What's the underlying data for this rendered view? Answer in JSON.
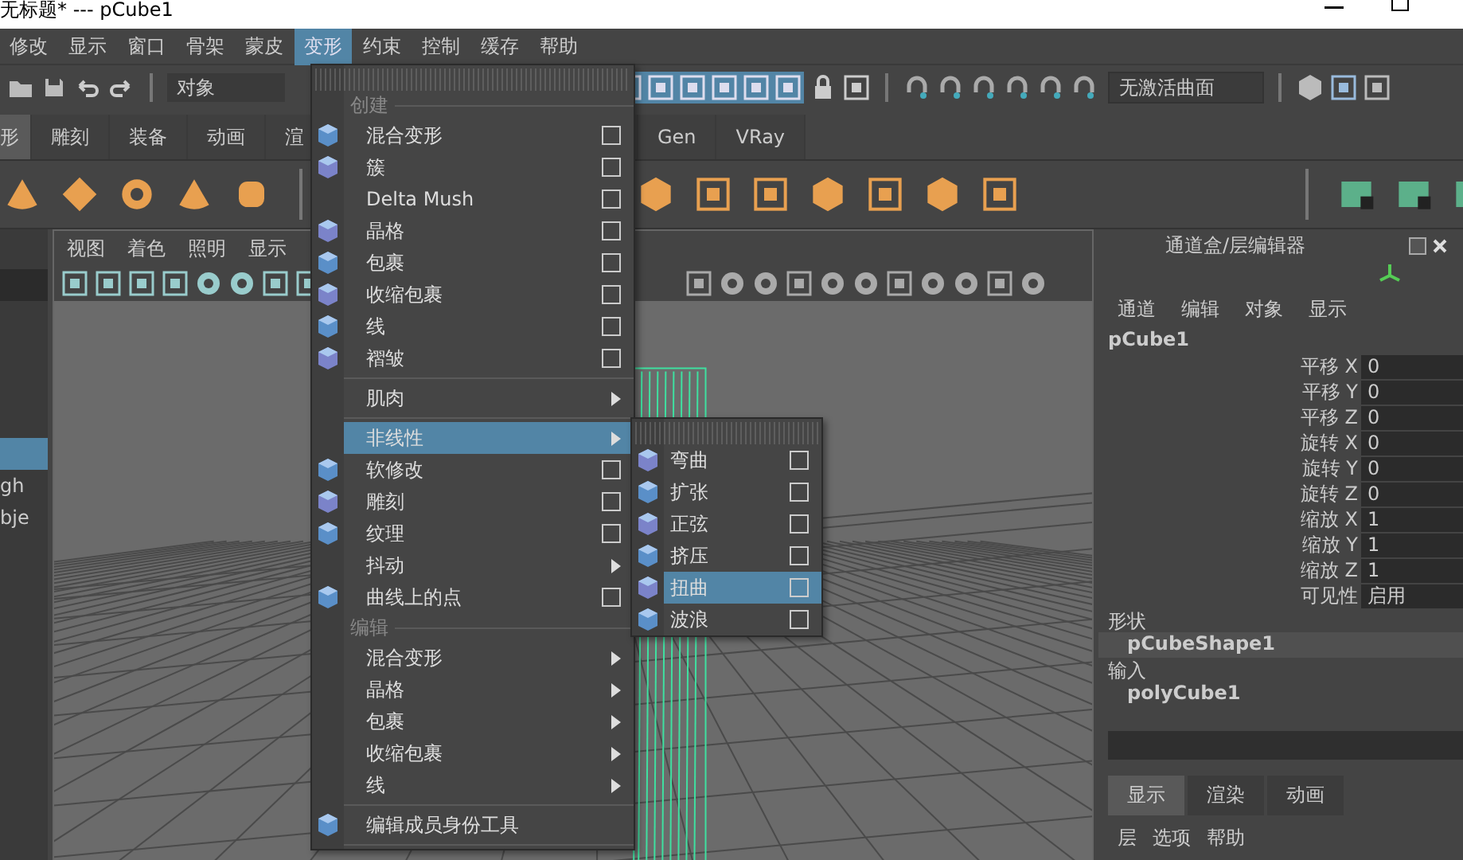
{
  "window": {
    "title": "无标题*   ---   pCube1"
  },
  "menu_bar": [
    {
      "label": "修改",
      "selected": false
    },
    {
      "label": "显示",
      "selected": false
    },
    {
      "label": "窗口",
      "selected": false
    },
    {
      "label": "骨架",
      "selected": false
    },
    {
      "label": "蒙皮",
      "selected": false
    },
    {
      "label": "变形",
      "selected": true
    },
    {
      "label": "约束",
      "selected": false
    },
    {
      "label": "控制",
      "selected": false
    },
    {
      "label": "缓存",
      "selected": false
    },
    {
      "label": "帮助",
      "selected": false
    }
  ],
  "toolbar": {
    "mode_dropdown": "对象",
    "live_surface_field": "无激活曲面"
  },
  "shelf_tabs": [
    {
      "label": "形",
      "selected": true
    },
    {
      "label": "雕刻",
      "selected": false
    },
    {
      "label": "装备",
      "selected": false
    },
    {
      "label": "动画",
      "selected": false
    },
    {
      "label": "渲",
      "selected": false
    },
    {
      "label": "Gen",
      "selected": false
    },
    {
      "label": "VRay",
      "selected": false
    }
  ],
  "outliner": {
    "rows": [
      {
        "selected": true
      },
      {
        "label": "gh",
        "selected": false
      },
      {
        "label": "bje",
        "selected": false
      }
    ]
  },
  "viewport": {
    "menus": [
      "视图",
      "着色",
      "照明",
      "显示"
    ]
  },
  "deform_menu": {
    "items": [
      {
        "kind": "header",
        "label": "创建"
      },
      {
        "kind": "option",
        "label": "混合变形",
        "has_icon": true,
        "selected": false
      },
      {
        "kind": "option",
        "label": "簇",
        "has_icon": true,
        "selected": false
      },
      {
        "kind": "option",
        "label": "Delta Mush",
        "has_icon": false,
        "selected": false
      },
      {
        "kind": "option",
        "label": "晶格",
        "has_icon": true,
        "selected": false
      },
      {
        "kind": "option",
        "label": "包裹",
        "has_icon": true,
        "selected": false
      },
      {
        "kind": "option",
        "label": "收缩包裹",
        "has_icon": true,
        "selected": false
      },
      {
        "kind": "option",
        "label": "线",
        "has_icon": true,
        "selected": false
      },
      {
        "kind": "option",
        "label": "褶皱",
        "has_icon": true,
        "selected": false
      },
      {
        "kind": "separator"
      },
      {
        "kind": "submenu",
        "label": "肌肉",
        "has_icon": false,
        "selected": false
      },
      {
        "kind": "separator"
      },
      {
        "kind": "submenu",
        "label": "非线性",
        "has_icon": false,
        "selected": true
      },
      {
        "kind": "option",
        "label": "软修改",
        "has_icon": true,
        "selected": false
      },
      {
        "kind": "option",
        "label": "雕刻",
        "has_icon": true,
        "selected": false
      },
      {
        "kind": "option",
        "label": "纹理",
        "has_icon": true,
        "selected": false
      },
      {
        "kind": "submenu",
        "label": "抖动",
        "has_icon": false,
        "selected": false
      },
      {
        "kind": "option",
        "label": "曲线上的点",
        "has_icon": true,
        "selected": false
      },
      {
        "kind": "header",
        "label": "编辑"
      },
      {
        "kind": "submenu",
        "label": "混合变形",
        "has_icon": false,
        "selected": false
      },
      {
        "kind": "submenu",
        "label": "晶格",
        "has_icon": false,
        "selected": false
      },
      {
        "kind": "submenu",
        "label": "包裹",
        "has_icon": false,
        "selected": false
      },
      {
        "kind": "submenu",
        "label": "收缩包裹",
        "has_icon": false,
        "selected": false
      },
      {
        "kind": "submenu",
        "label": "线",
        "has_icon": false,
        "selected": false
      },
      {
        "kind": "separator"
      },
      {
        "kind": "plain",
        "label": "编辑成员身份工具",
        "has_icon": true,
        "selected": false
      },
      {
        "kind": "separator"
      }
    ]
  },
  "nonlinear_menu": {
    "items": [
      {
        "kind": "option",
        "label": "弯曲",
        "has_icon": true,
        "selected": false
      },
      {
        "kind": "option",
        "label": "扩张",
        "has_icon": true,
        "selected": false
      },
      {
        "kind": "option",
        "label": "正弦",
        "has_icon": true,
        "selected": false
      },
      {
        "kind": "option",
        "label": "挤压",
        "has_icon": true,
        "selected": false
      },
      {
        "kind": "option",
        "label": "扭曲",
        "has_icon": true,
        "selected": true
      },
      {
        "kind": "option",
        "label": "波浪",
        "has_icon": true,
        "selected": false
      }
    ]
  },
  "channel_box": {
    "title": "通道盒/层编辑器",
    "menus": [
      "通道",
      "编辑",
      "对象",
      "显示"
    ],
    "object": "pCube1",
    "attributes": [
      {
        "name": "平移 X",
        "value": "0"
      },
      {
        "name": "平移 Y",
        "value": "0"
      },
      {
        "name": "平移 Z",
        "value": "0"
      },
      {
        "name": "旋转 X",
        "value": "0"
      },
      {
        "name": "旋转 Y",
        "value": "0"
      },
      {
        "name": "旋转 Z",
        "value": "0"
      },
      {
        "name": "缩放 X",
        "value": "1"
      },
      {
        "name": "缩放 Y",
        "value": "1"
      },
      {
        "name": "缩放 Z",
        "value": "1"
      },
      {
        "name": "可见性",
        "value": "启用"
      }
    ],
    "shapes_label": "形状",
    "shape": "pCubeShape1",
    "inputs_label": "输入",
    "input": "polyCube1"
  },
  "layer_editor": {
    "tabs": [
      {
        "label": "显示",
        "selected": true
      },
      {
        "label": "渲染",
        "selected": false
      },
      {
        "label": "动画",
        "selected": false
      }
    ],
    "menus": [
      "层",
      "选项",
      "帮助"
    ]
  }
}
